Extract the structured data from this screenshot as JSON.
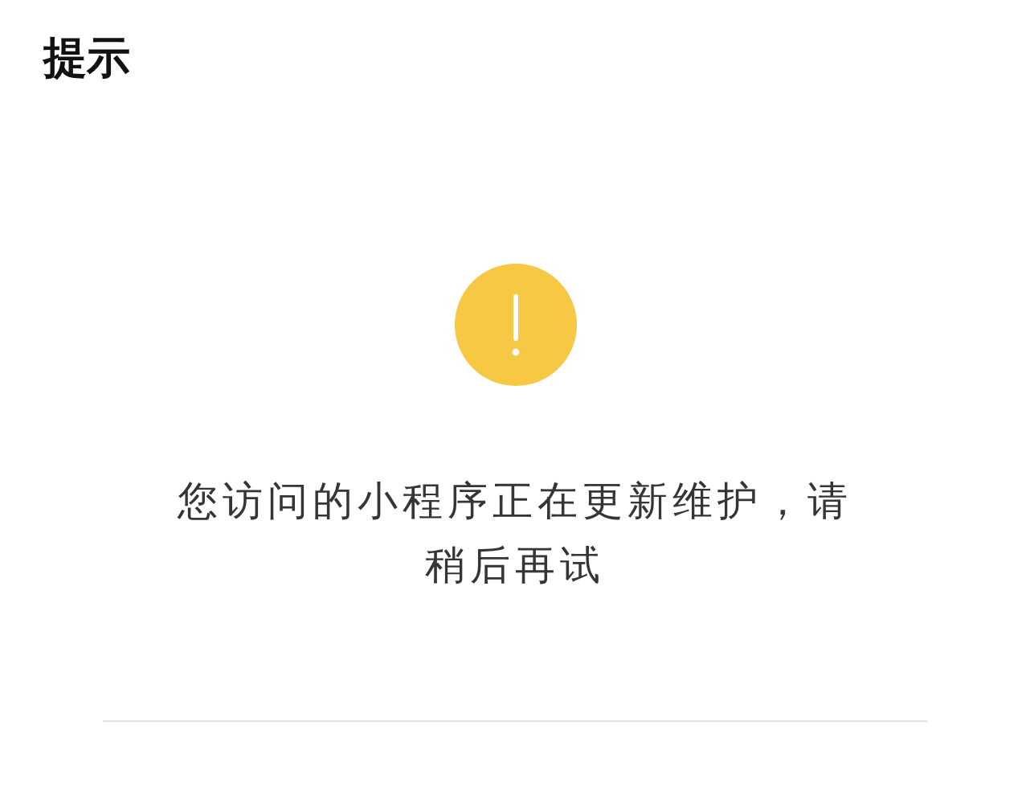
{
  "title": "提示",
  "message": "您访问的小程序正在更新维护，请稍后再试"
}
